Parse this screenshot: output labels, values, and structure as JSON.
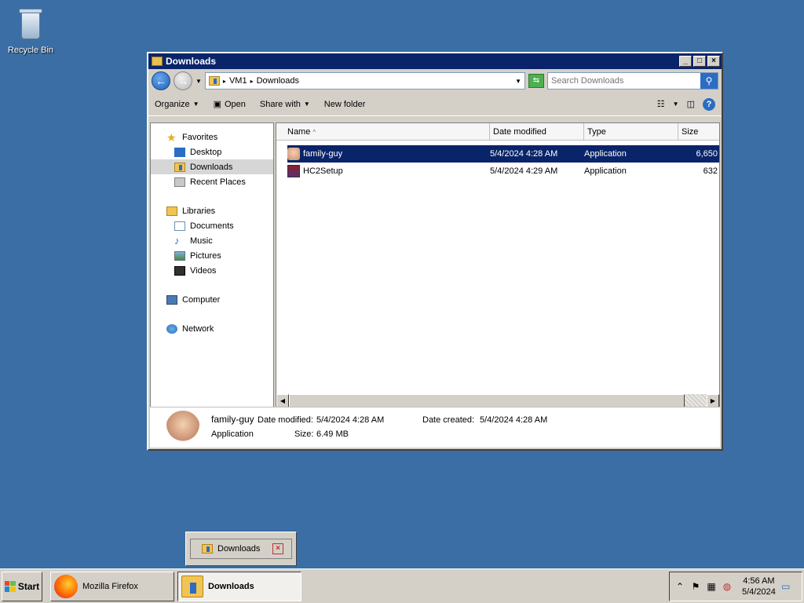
{
  "desktop": {
    "recycle_bin_label": "Recycle Bin"
  },
  "window": {
    "title": "Downloads",
    "address": {
      "segments": [
        "VM1",
        "Downloads"
      ]
    },
    "search_placeholder": "Search Downloads",
    "toolbar": {
      "organize": "Organize",
      "open": "Open",
      "share_with": "Share with",
      "new_folder": "New folder"
    },
    "nav": {
      "favorites": "Favorites",
      "fav_items": [
        "Desktop",
        "Downloads",
        "Recent Places"
      ],
      "libraries": "Libraries",
      "lib_items": [
        "Documents",
        "Music",
        "Pictures",
        "Videos"
      ],
      "computer": "Computer",
      "network": "Network"
    },
    "columns": {
      "name": "Name",
      "date": "Date modified",
      "type": "Type",
      "size": "Size"
    },
    "files": [
      {
        "name": "family-guy",
        "date": "5/4/2024 4:28 AM",
        "type": "Application",
        "size": "6,650"
      },
      {
        "name": "HC2Setup",
        "date": "5/4/2024 4:29 AM",
        "type": "Application",
        "size": "632"
      }
    ],
    "details": {
      "name": "family-guy",
      "date_modified_label": "Date modified:",
      "date_modified": "5/4/2024 4:28 AM",
      "date_created_label": "Date created:",
      "date_created": "5/4/2024 4:28 AM",
      "type": "Application",
      "size_label": "Size:",
      "size": "6.49 MB"
    }
  },
  "taskbar": {
    "start": "Start",
    "tasks": [
      "Mozilla Firefox",
      "Downloads"
    ],
    "popup_label": "Downloads",
    "clock_time": "4:56 AM",
    "clock_date": "5/4/2024"
  }
}
